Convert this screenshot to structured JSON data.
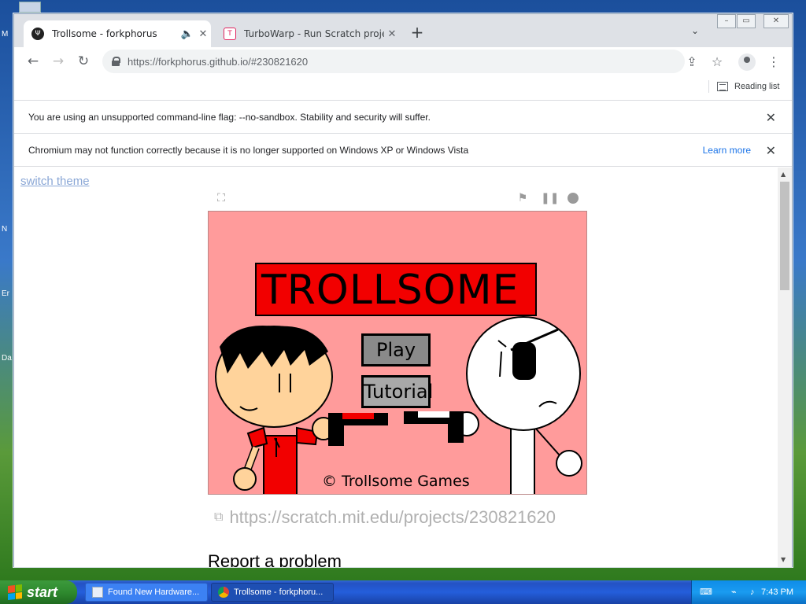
{
  "desktop": {
    "labels": [
      "M",
      "N",
      "Er",
      "Da"
    ]
  },
  "browser": {
    "tabs": [
      {
        "title": "Trollsome - forkphorus",
        "active": true
      },
      {
        "title": "TurboWarp - Run Scratch projects fa",
        "active": false
      }
    ],
    "new_tab_label": "+",
    "url": "https://forkphorus.github.io/#230821620",
    "reading_list_label": "Reading list"
  },
  "infobars": {
    "sandbox": {
      "text": "You are using an unsupported command-line flag: --no-sandbox. Stability and security will suffer."
    },
    "unsupported": {
      "text": "Chromium may not function correctly because it is no longer supported on Windows XP or Windows Vista",
      "learn_more": "Learn more"
    }
  },
  "page": {
    "switch_theme": "switch theme",
    "game": {
      "title": "TROLLSOME",
      "play_label": "Play",
      "tutorial_label": "Tutorial",
      "copyright": "© Trollsome Games"
    },
    "project_link": "https://scratch.mit.edu/projects/230821620",
    "report_problem": "Report a problem"
  },
  "taskbar": {
    "start_label": "start",
    "tasks": [
      {
        "label": "Found New Hardware..."
      },
      {
        "label": "Trollsome - forkphoru..."
      }
    ],
    "clock": "7:43 PM"
  },
  "colors": {
    "stage_bg": "#ff9b9b",
    "title_red": "#f20000",
    "link_blue": "#1a73e8"
  }
}
